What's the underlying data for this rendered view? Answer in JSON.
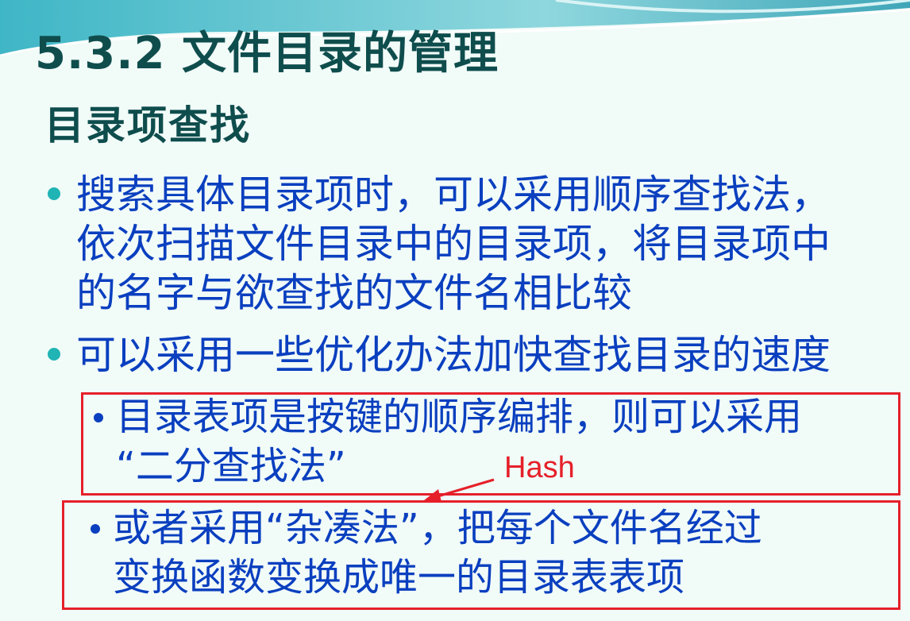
{
  "slide": {
    "title": "5.3.2 文件目录的管理",
    "subtitle": "目录项查找",
    "bullets": [
      {
        "lines": [
          "搜索具体目录项时，可以采用顺序查找法，",
          "依次扫描文件目录中的目录项，将目录项中",
          "的名字与欲查找的文件名相比较"
        ]
      },
      {
        "lines": [
          "可以采用一些优化办法加快查找目录的速度"
        ]
      }
    ],
    "sub_bullets": [
      {
        "lines": [
          "目录表项是按键的顺序编排，则可以采用",
          "“二分查找法”"
        ]
      },
      {
        "lines": [
          "或者采用“杂凑法”，把每个文件名经过",
          "变换函数变换成唯一的目录表表项"
        ]
      }
    ],
    "annotation": "Hash",
    "colors": {
      "heading": "#0f4d4d",
      "body": "#0a3fbf",
      "accent": "#20b4b4",
      "annotation": "#e5202a"
    }
  }
}
